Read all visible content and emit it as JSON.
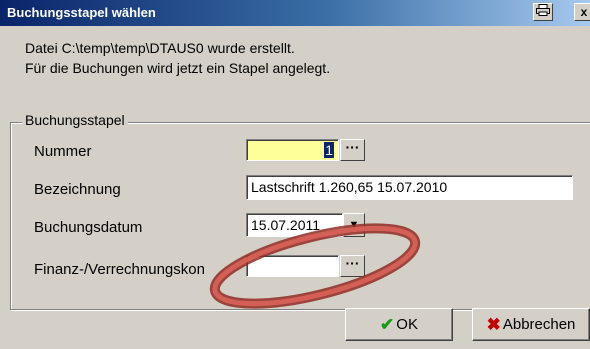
{
  "window": {
    "title": "Buchungsstapel wählen",
    "print_icon": "printer-icon",
    "close_label": "x"
  },
  "message": {
    "line1": "Datei C:\\temp\\temp\\DTAUS0 wurde erstellt.",
    "line2": "Für die Buchungen wird jetzt ein Stapel angelegt."
  },
  "group": {
    "title": "Buchungsstapel",
    "fields": {
      "nummer": {
        "label": "Nummer",
        "value": "1"
      },
      "bezeichnung": {
        "label": "Bezeichnung",
        "value": "Lastschrift 1.260,65 15.07.2010"
      },
      "buchungsdatum": {
        "label": "Buchungsdatum",
        "value": "15.07.2011"
      },
      "finanz": {
        "label": "Finanz-/Verrechnungskon",
        "value": ""
      }
    },
    "ellipsis_label": "···",
    "dropdown_icon": "chevron-down-icon"
  },
  "buttons": {
    "ok": "OK",
    "cancel": "Abbrechen"
  },
  "colors": {
    "highlight_field": "#ffff99",
    "annotation": "#c0392b",
    "titlebar": "#0a246a"
  }
}
